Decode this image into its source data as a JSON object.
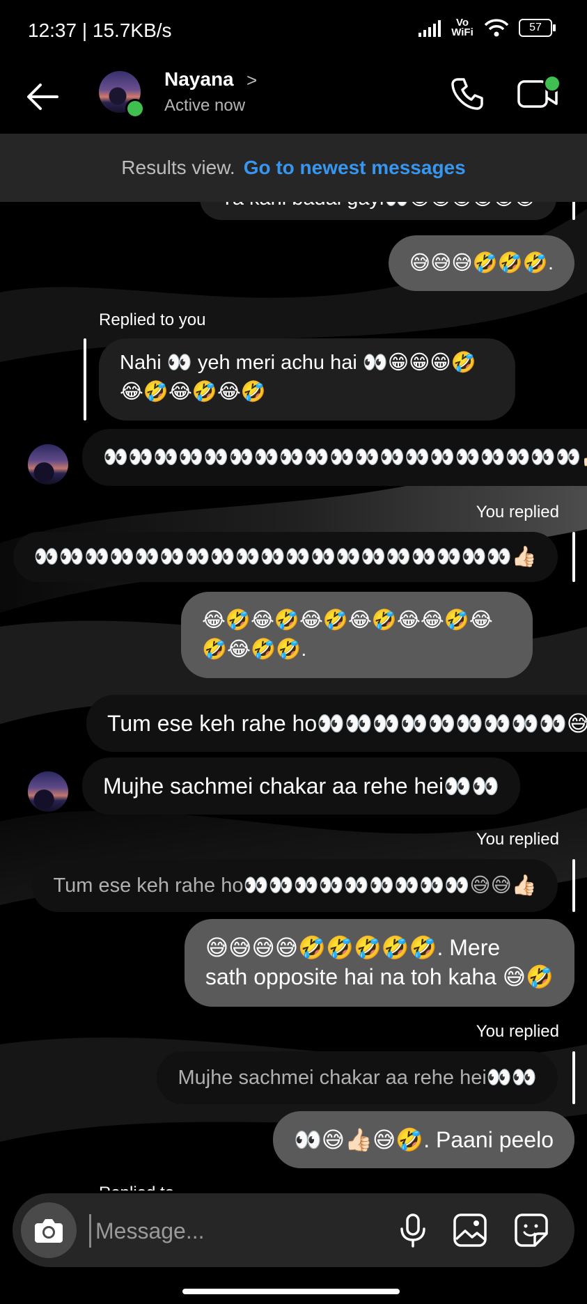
{
  "status_bar": {
    "time": "12:37 | 15.7KB/s",
    "network": "Vo WiFi",
    "battery": "57"
  },
  "header": {
    "name": "Nayana",
    "status": "Active now",
    "chevron": ">"
  },
  "banner": {
    "results": "Results view.",
    "link": "Go to newest messages"
  },
  "messages": {
    "m0": "Ya kahi badal gayi👀😁😁😁😁😁😁",
    "m1": "😅😅😅🤣🤣🤣.",
    "label_replied_to_you": "Replied to you",
    "m2_line1": "Nahi 👀 yeh meri achu hai 👀😁😁😁🤣",
    "m2_line2": "😂🤣😂🤣😂🤣",
    "m3": "👀👀👀👀👀👀👀👀👀👀👀👀👀👀👀👀👀👀👀👍🏻",
    "label_you_replied_1": "You replied",
    "m4_quote": "👀👀👀👀👀👀👀👀👀👀👀👀👀👀👀👀👀👀👀👍🏻",
    "m5_line1": "😂🤣😂🤣😂🤣😂🤣😂😂🤣😂",
    "m5_line2": "🤣😂🤣🤣.",
    "m6": "Tum ese keh rahe ho👀👀👀👀👀👀👀👀👀😅😅👍🏻",
    "m7": "Mujhe sachmei chakar aa rehe hei👀👀",
    "label_you_replied_2": "You replied",
    "m8_quote": "Tum ese keh rahe ho👀👀👀👀👀👀👀👀👀😅😅👍🏻",
    "m9_line1": "😅😅😅😅🤣🤣🤣🤣🤣. Mere",
    "m9_line2": "sath opposite hai na toh kaha 😅🤣",
    "label_you_replied_3": "You replied",
    "m10_quote": "Mujhe sachmei chakar aa rehe hei👀👀",
    "m11": "👀😅👍🏻😅🤣. Paani peelo",
    "label_partial": "Replied to"
  },
  "composer": {
    "placeholder": "Message..."
  },
  "icons": [
    "back-arrow-icon",
    "chevron-right-icon",
    "phone-icon",
    "video-call-icon",
    "camera-icon",
    "microphone-icon",
    "gallery-icon",
    "sticker-icon"
  ],
  "colors": {
    "link": "#3797f0",
    "my_bubble": "#5a5a5a",
    "their_bubble": "#242424",
    "online": "#3fbf4f"
  }
}
